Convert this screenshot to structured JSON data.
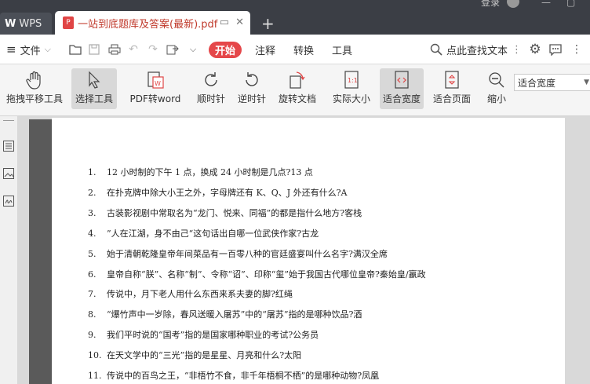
{
  "titlebar": {
    "wps_tab": "WPS",
    "doc_tab": "一站到底题库及答案(最新).pdf",
    "login": "登录"
  },
  "menubar": {
    "file": "文件",
    "start": "开始",
    "annotate": "注释",
    "convert": "转换",
    "tools": "工具",
    "search": "点此查找文本"
  },
  "toolbar": {
    "pan": "拖拽平移工具",
    "select": "选择工具",
    "pdf2word": "PDF转word",
    "clockwise": "顺时针",
    "counter": "逆时针",
    "rotate": "旋转文档",
    "actual": "实际大小",
    "fitwidth": "适合宽度",
    "fitpage": "适合页面",
    "zoomout": "缩小",
    "zoom_value": "适合宽度"
  },
  "questions": [
    {
      "n": "1.",
      "t": "12 小时制的下午 1 点，换成 24 小时制是几点?13 点"
    },
    {
      "n": "2.",
      "t": "在扑克牌中除大小王之外，字母牌还有 K、Q、J 外还有什么?A"
    },
    {
      "n": "3.",
      "t": "古装影视剧中常取名为“龙门、悦来、同福”的都是指什么地方?客栈"
    },
    {
      "n": "4.",
      "t": "”人在江湖，身不由己“这句话出自哪一位武侠作家?古龙"
    },
    {
      "n": "5.",
      "t": "始于清朝乾隆皇帝年间菜品有一百零八种的官廷盛宴叫什么名字?满汉全席"
    },
    {
      "n": "6.",
      "t": "皇帝自称“朕”、名称“制”、令称“诏”、印称“玺”始于我国古代哪位皇帝?秦始皇/嬴政"
    },
    {
      "n": "7.",
      "t": "传说中，月下老人用什么东西来系夫妻的脚?红绳"
    },
    {
      "n": "8.",
      "t": "“爆竹声中一岁除，春风送暖入屠苏”中的“屠苏”指的是哪种饮品?酒"
    },
    {
      "n": "9.",
      "t": "我们平时说的“国考”指的是国家哪种职业的考试?公务员"
    },
    {
      "n": "10.",
      "t": "在天文学中的“三光”指的是星星、月亮和什么?太阳"
    },
    {
      "n": "11.",
      "t": "传说中的百鸟之王，“非梧竹不食，非千年梧桐不栖”的是哪种动物?凤凰"
    }
  ]
}
